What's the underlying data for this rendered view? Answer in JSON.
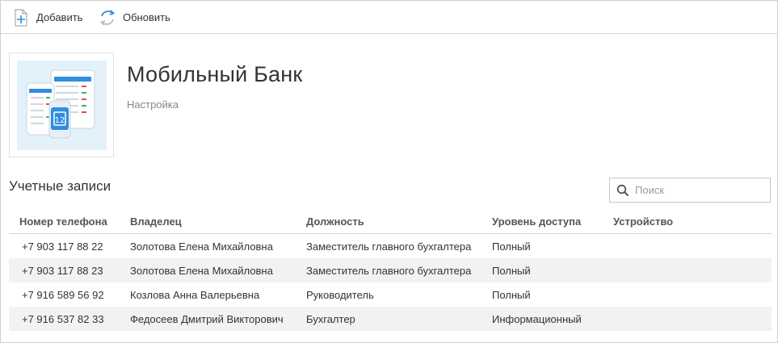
{
  "toolbar": {
    "add_label": "Добавить",
    "refresh_label": "Обновить"
  },
  "app": {
    "title": "Мобильный Банк",
    "subtitle": "Настройка"
  },
  "accounts": {
    "title": "Учетные записи",
    "search_placeholder": "Поиск",
    "columns": [
      "Номер телефона",
      "Владелец",
      "Должность",
      "Уровень доступа",
      "Устройство"
    ],
    "rows": [
      [
        "+7 903 117 88 22",
        "Золотова Елена Михайловна",
        "Заместитель главного бухгалтера",
        "Полный",
        ""
      ],
      [
        "+7 903 117 88 23",
        "Золотова Елена Михайловна",
        "Заместитель главного бухгалтера",
        "Полный",
        ""
      ],
      [
        "+7 916 589 56 92",
        "Козлова Анна Валерьевна",
        "Руководитель",
        "Полный",
        ""
      ],
      [
        "+7 916 537 82 33",
        "Федосеев Дмитрий Викторович",
        "Бухгалтер",
        "Информационный",
        ""
      ]
    ]
  },
  "colors": {
    "accent": "#2f8ee0",
    "row_alt": "#f2f2f2",
    "border": "#d6d6d6"
  },
  "icons": {
    "add": "plus-document-icon",
    "refresh": "refresh-icon",
    "search": "search-icon",
    "app": "mobile-bank-app-icon"
  }
}
